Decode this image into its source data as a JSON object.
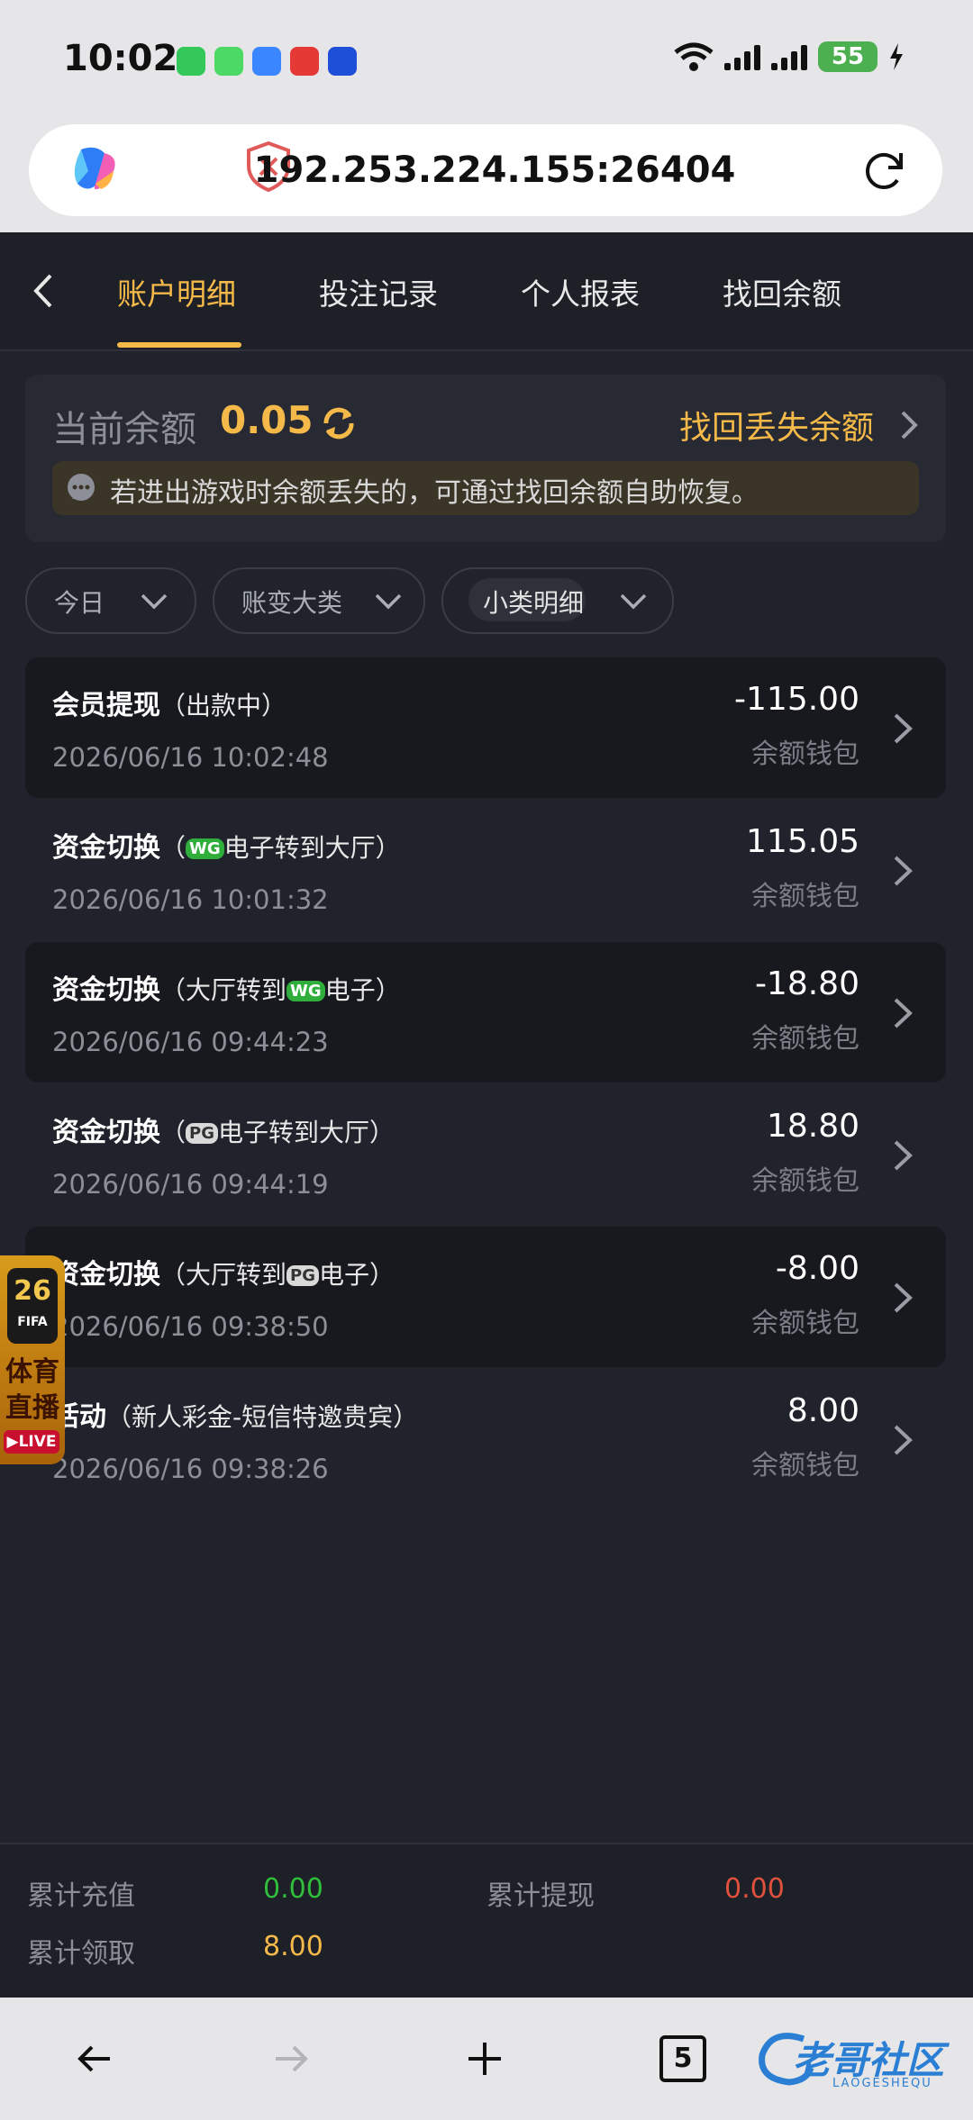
{
  "status_bar": {
    "time": "10:02",
    "battery": "55"
  },
  "browser": {
    "url": "192.253.224.155:26404",
    "tab_count": "5"
  },
  "nav": {
    "tabs": [
      {
        "label": "账户明细",
        "active": true
      },
      {
        "label": "投注记录",
        "active": false
      },
      {
        "label": "个人报表",
        "active": false
      },
      {
        "label": "找回余额",
        "active": false
      }
    ]
  },
  "balance": {
    "label": "当前余额",
    "value": "0.05",
    "recover_link": "找回丢失余额",
    "notice": "若进出游戏时余额丢失的，可通过找回余额自助恢复。"
  },
  "filters": [
    {
      "label": "今日"
    },
    {
      "label": "账变大类"
    },
    {
      "label": "小类明细"
    }
  ],
  "records": [
    {
      "type": "会员提现",
      "open": "（",
      "pre": "出款中",
      "logo": "",
      "post": "",
      "close": "）",
      "time": "2026/06/16 10:02:48",
      "amount": "-115.00",
      "wallet": "余额钱包"
    },
    {
      "type": "资金切换",
      "open": "（",
      "pre": "",
      "logo": "WG",
      "post": "电子转到大厅",
      "close": "）",
      "time": "2026/06/16 10:01:32",
      "amount": "115.05",
      "wallet": "余额钱包"
    },
    {
      "type": "资金切换",
      "open": "（",
      "pre": "大厅转到",
      "logo": "WG",
      "post": "电子",
      "close": "）",
      "time": "2026/06/16 09:44:23",
      "amount": "-18.80",
      "wallet": "余额钱包"
    },
    {
      "type": "资金切换",
      "open": "（",
      "pre": "",
      "logo": "PG",
      "post": "电子转到大厅",
      "close": "）",
      "time": "2026/06/16 09:44:19",
      "amount": "18.80",
      "wallet": "余额钱包"
    },
    {
      "type": "资金切换",
      "open": "（",
      "pre": "大厅转到",
      "logo": "PG",
      "post": "电子",
      "close": "）",
      "time": "2026/06/16 09:38:50",
      "amount": "-8.00",
      "wallet": "余额钱包"
    },
    {
      "type": "活动",
      "open": "（",
      "pre": "新人彩金-短信特邀贵宾",
      "logo": "",
      "post": "",
      "close": "）",
      "time": "2026/06/16 09:38:26",
      "amount": "8.00",
      "wallet": "余额钱包"
    }
  ],
  "summary": {
    "deposit_label": "累计充值",
    "deposit_value": "0.00",
    "withdraw_label": "累计提现",
    "withdraw_value": "0.00",
    "claim_label": "累计领取",
    "claim_value": "8.00"
  },
  "badge": {
    "number": "26",
    "fifa": "FIFA",
    "line1": "体育",
    "line2": "直播",
    "live": "LIVE"
  },
  "watermark": {
    "text": "老哥社区",
    "sub": "LAOGESHEQU"
  },
  "colors": {
    "accent": "#f5b949",
    "positive": "#2fbf3a",
    "negative": "#e0513d",
    "background": "#20232b"
  }
}
